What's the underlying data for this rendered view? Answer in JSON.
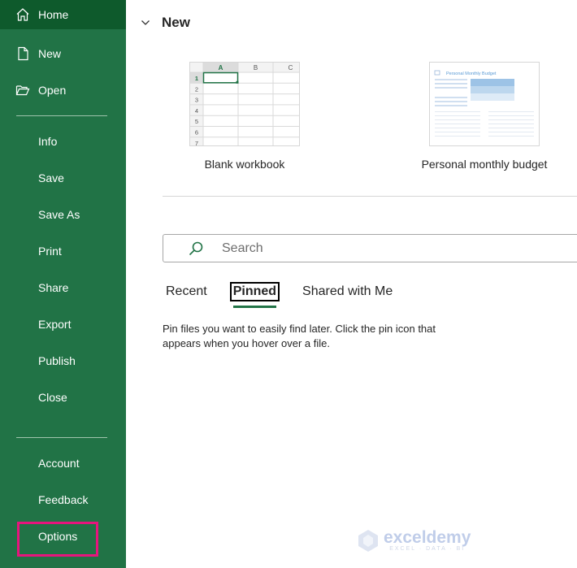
{
  "sidebar": {
    "items": [
      {
        "label": "Home",
        "icon": "home-icon"
      },
      {
        "label": "New",
        "icon": "new-document-icon"
      },
      {
        "label": "Open",
        "icon": "folder-open-icon"
      },
      {
        "label": "Info"
      },
      {
        "label": "Save"
      },
      {
        "label": "Save As"
      },
      {
        "label": "Print"
      },
      {
        "label": "Share"
      },
      {
        "label": "Export"
      },
      {
        "label": "Publish"
      },
      {
        "label": "Close"
      },
      {
        "label": "Account"
      },
      {
        "label": "Feedback"
      },
      {
        "label": "Options",
        "highlighted": true
      }
    ],
    "colors": {
      "background": "#217346",
      "home_active": "#0e5a2c",
      "highlight_box": "#e6157d"
    }
  },
  "main": {
    "section_title": "New",
    "templates": [
      {
        "label": "Blank workbook",
        "grid": {
          "columns": [
            "A",
            "B",
            "C"
          ],
          "rows": [
            "1",
            "2",
            "3",
            "4",
            "5",
            "6",
            "7"
          ],
          "selected_cell": "A1"
        }
      },
      {
        "label": "Personal monthly budget",
        "thumb_title": "Personal Monthly Budget"
      }
    ],
    "search": {
      "placeholder": "Search",
      "value": ""
    },
    "tabs": [
      {
        "label": "Recent",
        "active": false
      },
      {
        "label": "Pinned",
        "active": true
      },
      {
        "label": "Shared with Me",
        "active": false
      }
    ],
    "pinned_hint": "Pin files you want to easily find later. Click the pin icon that appears when you hover over a file.",
    "accent_color": "#217346"
  },
  "watermark": {
    "brand": "exceldemy",
    "tagline": "EXCEL · DATA · BI"
  }
}
